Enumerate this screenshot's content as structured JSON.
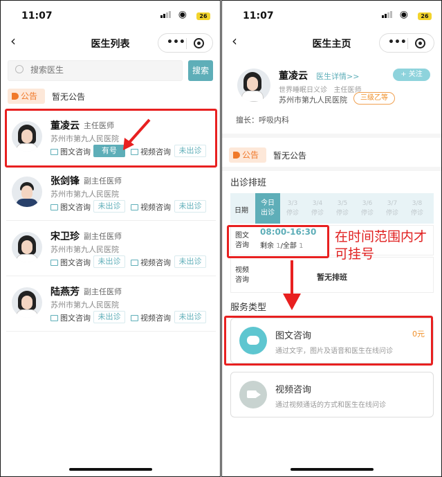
{
  "left": {
    "status": {
      "time": "11:07",
      "battery": "26"
    },
    "nav": {
      "title": "医生列表"
    },
    "search": {
      "placeholder": "搜索医生",
      "button": "搜索"
    },
    "notice": {
      "badge": "公告",
      "text": "暂无公告"
    },
    "doctors": [
      {
        "name": "董凌云",
        "title": "主任医师",
        "hospital": "苏州市第九人民医院",
        "text_consult": "图文咨询",
        "text_status": "有号",
        "video_consult": "视频咨询",
        "video_status": "未出诊"
      },
      {
        "name": "张剑锋",
        "title": "副主任医师",
        "hospital": "苏州市第九人民医院",
        "text_consult": "图文咨询",
        "text_status": "未出诊",
        "video_consult": "视频咨询",
        "video_status": "未出诊"
      },
      {
        "name": "宋卫珍",
        "title": "副主任医师",
        "hospital": "苏州市第九人民医院",
        "text_consult": "图文咨询",
        "text_status": "未出诊",
        "video_consult": "视频咨询",
        "video_status": "未出诊"
      },
      {
        "name": "陆燕芳",
        "title": "副主任医师",
        "hospital": "苏州市第九人民医院",
        "text_consult": "图文咨询",
        "text_status": "未出诊",
        "video_consult": "视频咨询",
        "video_status": "未出诊"
      }
    ]
  },
  "right": {
    "status": {
      "time": "11:07",
      "battery": "26"
    },
    "nav": {
      "title": "医生主页"
    },
    "profile": {
      "name": "董凌云",
      "detail_link": "医生详情>>",
      "follow": "+ 关注",
      "dept": "世界睡眠日义诊",
      "title": "主任医师",
      "hospital": "苏州市第九人民医院",
      "grade": "三级乙等",
      "specialty": "擅长：呼吸内科"
    },
    "notice": {
      "badge": "公告",
      "text": "暂无公告"
    },
    "schedule": {
      "heading": "出诊排班",
      "date_label": "日期",
      "today": {
        "l1": "今日",
        "l2": "出诊"
      },
      "days": [
        {
          "date": "3/3",
          "status": "停诊"
        },
        {
          "date": "3/4",
          "status": "停诊"
        },
        {
          "date": "3/5",
          "status": "停诊"
        },
        {
          "date": "3/6",
          "status": "停诊"
        },
        {
          "date": "3/7",
          "status": "停诊"
        },
        {
          "date": "3/8",
          "status": "停诊"
        }
      ],
      "text_row": {
        "label1": "图文",
        "label2": "咨询",
        "time": "08:00-16:30",
        "remain": "剩余",
        "remain_num": "1",
        "total": "/全部",
        "total_num": "1"
      },
      "video_row": {
        "label1": "视频",
        "label2": "咨询",
        "empty": "暂无排班"
      }
    },
    "annotation": "在时间范围内才可挂号",
    "services_heading": "服务类型",
    "services": [
      {
        "title": "图文咨询",
        "desc": "通过文字，图片及语音和医生在线问诊",
        "price": "0元"
      },
      {
        "title": "视频咨询",
        "desc": "通过视频通话的方式和医生在线问诊",
        "price": ""
      }
    ]
  },
  "colors": {
    "accent": "#5eaeb8",
    "annotation_red": "#e82020",
    "orange": "#f0902a"
  }
}
